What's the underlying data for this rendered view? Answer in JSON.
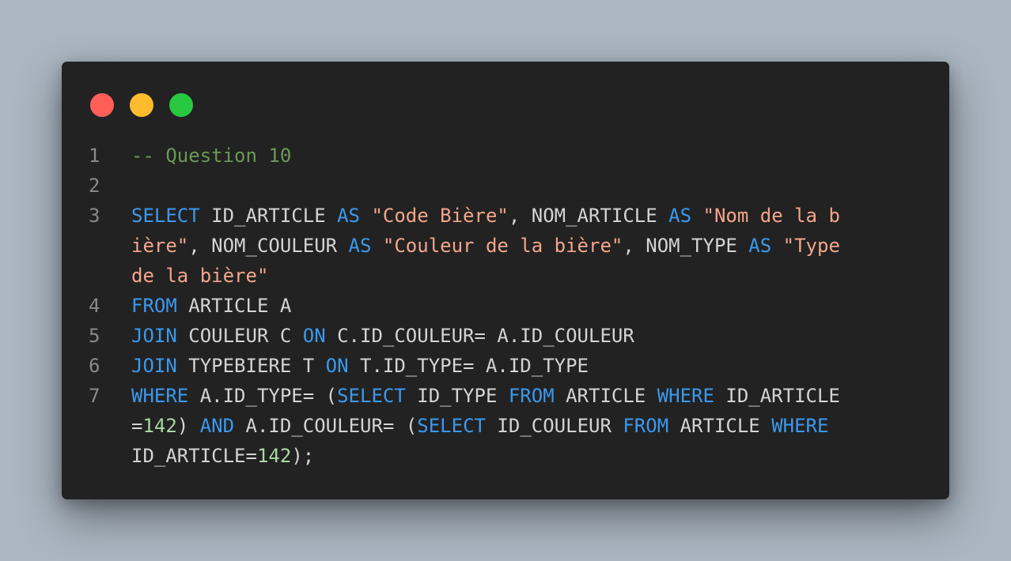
{
  "window": {
    "controls": [
      {
        "name": "close",
        "color": "#ff5f57"
      },
      {
        "name": "minimize",
        "color": "#febc2e"
      },
      {
        "name": "maximize",
        "color": "#28c840"
      }
    ]
  },
  "colors": {
    "keyword": "#3b99ee",
    "string": "#f4a58a",
    "number": "#a8d8a0",
    "comment": "#6a9955",
    "text": "#d4d4d4",
    "line_number": "#8a8a8a",
    "editor_background": "#222222",
    "page_background": "#abb6c2"
  },
  "code": {
    "lines": [
      {
        "number": "1",
        "rows": [
          [
            {
              "t": "cm",
              "v": "-- Question 10"
            }
          ]
        ]
      },
      {
        "number": "2",
        "rows": [
          []
        ]
      },
      {
        "number": "3",
        "rows": [
          [
            {
              "t": "kw",
              "v": "SELECT"
            },
            {
              "t": "tx",
              "v": " ID_ARTICLE "
            },
            {
              "t": "kw",
              "v": "AS"
            },
            {
              "t": "tx",
              "v": " "
            },
            {
              "t": "str",
              "v": "\"Code Bière\""
            },
            {
              "t": "tx",
              "v": ", NOM_ARTICLE "
            },
            {
              "t": "kw",
              "v": "AS"
            },
            {
              "t": "tx",
              "v": " "
            },
            {
              "t": "str",
              "v": "\"Nom de la b"
            }
          ],
          [
            {
              "t": "str",
              "v": "ière\""
            },
            {
              "t": "tx",
              "v": ", NOM_COULEUR "
            },
            {
              "t": "kw",
              "v": "AS"
            },
            {
              "t": "tx",
              "v": " "
            },
            {
              "t": "str",
              "v": "\"Couleur de la bière\""
            },
            {
              "t": "tx",
              "v": ", NOM_TYPE "
            },
            {
              "t": "kw",
              "v": "AS"
            },
            {
              "t": "tx",
              "v": " "
            },
            {
              "t": "str",
              "v": "\"Type"
            }
          ],
          [
            {
              "t": "str",
              "v": "de la bière\""
            }
          ]
        ]
      },
      {
        "number": "4",
        "rows": [
          [
            {
              "t": "kw",
              "v": "FROM"
            },
            {
              "t": "tx",
              "v": " ARTICLE A"
            }
          ]
        ]
      },
      {
        "number": "5",
        "rows": [
          [
            {
              "t": "kw",
              "v": "JOIN"
            },
            {
              "t": "tx",
              "v": " COULEUR C "
            },
            {
              "t": "kw",
              "v": "ON"
            },
            {
              "t": "tx",
              "v": " C.ID_COULEUR= A.ID_COULEUR"
            }
          ]
        ]
      },
      {
        "number": "6",
        "rows": [
          [
            {
              "t": "kw",
              "v": "JOIN"
            },
            {
              "t": "tx",
              "v": " TYPEBIERE T "
            },
            {
              "t": "kw",
              "v": "ON"
            },
            {
              "t": "tx",
              "v": " T.ID_TYPE= A.ID_TYPE"
            }
          ]
        ]
      },
      {
        "number": "7",
        "rows": [
          [
            {
              "t": "kw",
              "v": "WHERE"
            },
            {
              "t": "tx",
              "v": " A.ID_TYPE= ("
            },
            {
              "t": "kw",
              "v": "SELECT"
            },
            {
              "t": "tx",
              "v": " ID_TYPE "
            },
            {
              "t": "kw",
              "v": "FROM"
            },
            {
              "t": "tx",
              "v": " ARTICLE "
            },
            {
              "t": "kw",
              "v": "WHERE"
            },
            {
              "t": "tx",
              "v": " ID_ARTICLE"
            }
          ],
          [
            {
              "t": "tx",
              "v": "="
            },
            {
              "t": "num",
              "v": "142"
            },
            {
              "t": "tx",
              "v": ") "
            },
            {
              "t": "kw",
              "v": "AND"
            },
            {
              "t": "tx",
              "v": " A.ID_COULEUR= ("
            },
            {
              "t": "kw",
              "v": "SELECT"
            },
            {
              "t": "tx",
              "v": " ID_COULEUR "
            },
            {
              "t": "kw",
              "v": "FROM"
            },
            {
              "t": "tx",
              "v": " ARTICLE "
            },
            {
              "t": "kw",
              "v": "WHERE"
            }
          ],
          [
            {
              "t": "tx",
              "v": "ID_ARTICLE="
            },
            {
              "t": "num",
              "v": "142"
            },
            {
              "t": "tx",
              "v": ");"
            }
          ]
        ]
      }
    ]
  }
}
